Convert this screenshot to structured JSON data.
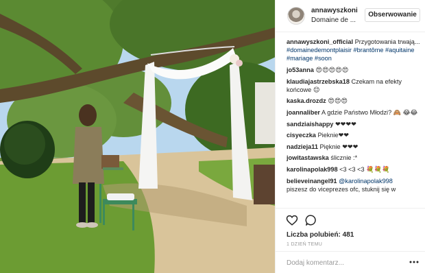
{
  "post": {
    "photo_alt": "",
    "header": {
      "username": "annawyszkoni",
      "location": "Domaine de ...",
      "follow_label": "Obserwowanie"
    },
    "caption": {
      "user": "annawyszkoni_official",
      "text": " Przygotowania trwają...",
      "hashtags": "#domainedemontplaisir #brantôme #aquitaine #mariage #soon"
    },
    "comments": [
      {
        "user": "jo53anna",
        "text": " 😍😍😍😍😍"
      },
      {
        "user": "klaudiajastrzebska18",
        "text": " Czekam na efekty końcowe 😌"
      },
      {
        "user": "kaska.drozdz",
        "text": " 😍😍😍"
      },
      {
        "user": "joannaliber",
        "text": " A gdzie Państwo Młodzi? 🙈 😂😂"
      },
      {
        "user": "sandziaishappy",
        "text": " ❤❤❤❤"
      },
      {
        "user": "cisyeczka",
        "text": " Pieknie❤❤"
      },
      {
        "user": "nadzieja11",
        "text": " Pięknie ❤❤❤"
      },
      {
        "user": "jowitastawska",
        "text": " ślicznie :*"
      },
      {
        "user": "karolinapolak998",
        "text": " <3 <3 <3 💐💐💐"
      },
      {
        "user": "believeinangel91",
        "mention": " @karolinapolak998",
        "text": " piszesz do viceprezes ofc, stuknij się w"
      }
    ],
    "likes_label": "Liczba polubień: 481",
    "time_label": "1 DZIEŃ TEMU",
    "add_comment_placeholder": "Dodaj komentarz..."
  },
  "icons": [
    "heart-icon",
    "comment-icon",
    "more-options-icon"
  ],
  "colors": {
    "border": "#efefef",
    "link": "#003569",
    "text": "#262626",
    "muted": "#999999"
  }
}
